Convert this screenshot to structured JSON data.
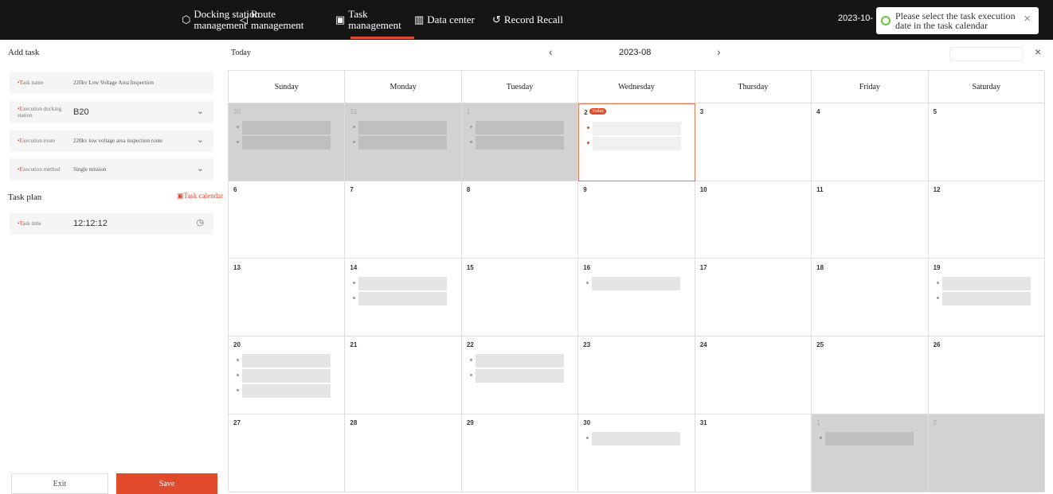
{
  "nav": {
    "items": [
      {
        "icon": "docking-station-icon",
        "label": "Docking station management"
      },
      {
        "icon": "route-icon",
        "label": "Route management"
      },
      {
        "icon": "task-icon",
        "label": "Task management"
      },
      {
        "icon": "data-center-icon",
        "label": "Data center"
      },
      {
        "icon": "record-recall-icon",
        "label": "Record Recall"
      }
    ],
    "active_index": 2,
    "date_stub": "2023-10-"
  },
  "toast": {
    "message": "Please select the task execution date in the task calendar",
    "close": "×",
    "icon": "success-icon"
  },
  "form": {
    "add_task_title": "Add task",
    "task_name_label": "•Task name",
    "task_name_value": "220kv Low Voltage Area Inspection",
    "docking_label": "•Execution docking station",
    "docking_value": "B20",
    "route_label": "•Execution route",
    "route_value": "220kv low voltage area inspection route",
    "method_label": "•Execution method",
    "method_value": "Single mission",
    "task_plan_title": "Task plan",
    "calendar_link": "Task calendar",
    "task_time_label": "•Task time",
    "task_time_value": "12:12:12",
    "exit_label": "Exit",
    "save_label": "Save"
  },
  "calendar": {
    "today_label": "Today",
    "prev": "‹",
    "month": "2023-08",
    "next": "›",
    "close": "×",
    "weekdays": [
      "Sunday",
      "Monday",
      "Tuesday",
      "Wednesday",
      "Thursday",
      "Friday",
      "Saturday"
    ],
    "today_badge": "Today",
    "days": [
      "30",
      "31",
      "1",
      "2",
      "3",
      "4",
      "5",
      "6",
      "7",
      "8",
      "9",
      "10",
      "11",
      "12",
      "13",
      "14",
      "15",
      "16",
      "17",
      "18",
      "19",
      "20",
      "21",
      "22",
      "23",
      "24",
      "25",
      "26",
      "27",
      "28",
      "29",
      "30",
      "31",
      "1",
      "2"
    ],
    "muted": [
      0,
      1,
      2,
      33,
      34
    ],
    "current_index": 3,
    "task_counts": [
      2,
      2,
      2,
      2,
      0,
      0,
      0,
      0,
      0,
      0,
      0,
      0,
      0,
      0,
      0,
      2,
      0,
      1,
      0,
      0,
      2,
      3,
      0,
      2,
      0,
      0,
      0,
      0,
      0,
      0,
      0,
      1,
      0,
      1,
      0
    ],
    "has_more": [
      0,
      1,
      2,
      21,
      23
    ]
  },
  "colors": {
    "accent": "#e14a2b",
    "topbar": "#151515"
  }
}
